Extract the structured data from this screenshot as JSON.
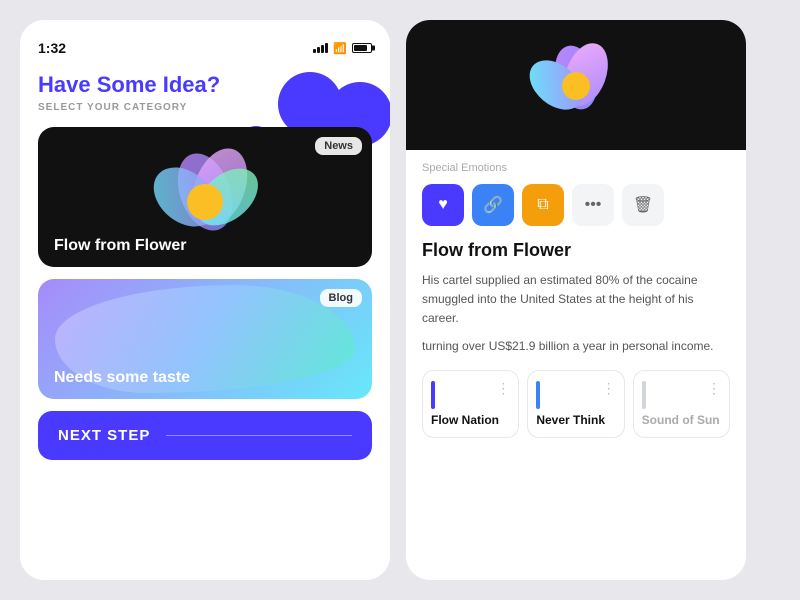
{
  "left": {
    "status": {
      "time": "1:32"
    },
    "hero": {
      "title": "Have Some Idea?",
      "subtitle": "SELECT YOUR CATEGORY"
    },
    "card1": {
      "badge": "News",
      "label": "Flow from Flower"
    },
    "card2": {
      "badge": "Blog",
      "label": "Needs some taste"
    },
    "button": {
      "label": "NEXT STEP"
    }
  },
  "right": {
    "special_label": "Special Emotions",
    "article": {
      "title": "Flow from Flower",
      "desc1": "His cartel supplied an estimated 80% of the cocaine smuggled into the United States at the height of his career.",
      "desc2": "turning over US$21.9 billion a year in personal income."
    },
    "tracks": [
      {
        "name": "Flow Nation",
        "bar_color": "purple",
        "disabled": false
      },
      {
        "name": "Never Think",
        "bar_color": "blue",
        "disabled": false
      },
      {
        "name": "Sound of Sun",
        "bar_color": "gray",
        "disabled": true
      }
    ],
    "actions": {
      "heart": "♥",
      "link": "🔗",
      "copy": "⧉",
      "more": "•••",
      "trash": "🗑"
    }
  }
}
